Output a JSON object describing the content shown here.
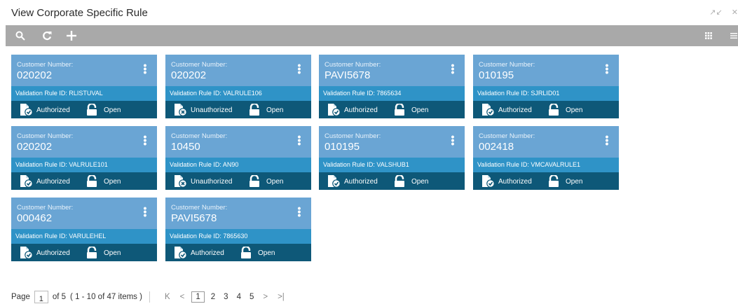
{
  "header": {
    "title": "View Corporate Specific Rule"
  },
  "toolbar": {
    "icons": [
      "search-icon",
      "refresh-icon",
      "add-icon",
      "grid-view-icon",
      "list-view-icon"
    ]
  },
  "cards": [
    {
      "customer_label": "Customer Number:",
      "customer_number": "020202",
      "rule_label": "Validation Rule ID: RLISTUVAL",
      "auth": "Authorized",
      "status": "Open"
    },
    {
      "customer_label": "Customer Number:",
      "customer_number": "020202",
      "rule_label": "Validation Rule ID: VALRULE106",
      "auth": "Unauthorized",
      "status": "Open"
    },
    {
      "customer_label": "Customer Number:",
      "customer_number": "PAVI5678",
      "rule_label": "Validation Rule ID: 7865634",
      "auth": "Authorized",
      "status": "Open"
    },
    {
      "customer_label": "Customer Number:",
      "customer_number": "010195",
      "rule_label": "Validation Rule ID: SJRLID01",
      "auth": "Authorized",
      "status": "Open"
    },
    {
      "customer_label": "Customer Number:",
      "customer_number": "020202",
      "rule_label": "Validation Rule ID: VALRULE101",
      "auth": "Authorized",
      "status": "Open"
    },
    {
      "customer_label": "Customer Number:",
      "customer_number": "10450",
      "rule_label": "Validation Rule ID: AN90",
      "auth": "Unauthorized",
      "status": "Open"
    },
    {
      "customer_label": "Customer Number:",
      "customer_number": "010195",
      "rule_label": "Validation Rule ID: VALSHUB1",
      "auth": "Authorized",
      "status": "Open"
    },
    {
      "customer_label": "Customer Number:",
      "customer_number": "002418",
      "rule_label": "Validation Rule ID: VMCAVALRULE1",
      "auth": "Authorized",
      "status": "Open"
    },
    {
      "customer_label": "Customer Number:",
      "customer_number": "000462",
      "rule_label": "Validation Rule ID: VARULEHEL",
      "auth": "Authorized",
      "status": "Open"
    },
    {
      "customer_label": "Customer Number:",
      "customer_number": "PAVI5678",
      "rule_label": "Validation Rule ID: 7865630",
      "auth": "Authorized",
      "status": "Open"
    }
  ],
  "pagination": {
    "page_label": "Page",
    "current_page": "1",
    "of_label": "of 5",
    "items_label": "( 1 - 10 of 47 items )",
    "pages": [
      "1",
      "2",
      "3",
      "4",
      "5"
    ]
  },
  "colors": {
    "card_top": "#6aa5d4",
    "card_mid": "#2f93c7",
    "card_bottom": "#0e5878",
    "toolbar": "#a9a9a9"
  }
}
